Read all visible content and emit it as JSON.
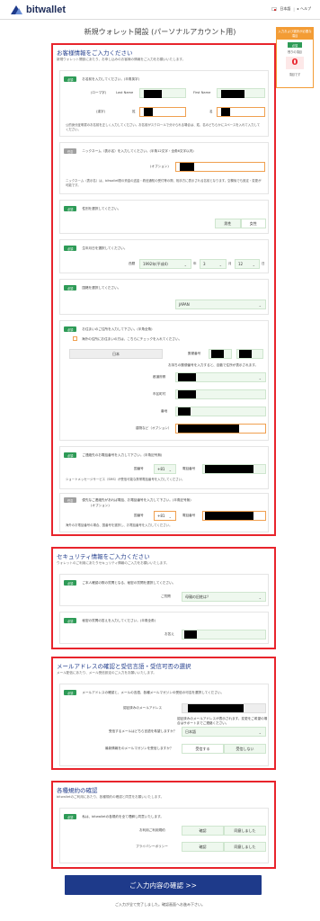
{
  "header": {
    "logo_text": "bitwallet",
    "language": "日本語",
    "separator": "|",
    "help": "▸ ヘルプ"
  },
  "page_title": "新規ウォレット開設 (パーソナルアカウント用)",
  "side": {
    "head": "入力および選択が必要な項目",
    "badge": "必須",
    "remaining_label": "残りの項目",
    "remaining_count": "0",
    "footer": "項目です"
  },
  "sec1": {
    "title": "お客様情報をご入力ください",
    "subtitle": "新規ウォレット開設にあたり、お申し込みのお客様の情報をご入力をお願いいたします。",
    "badge_required": "必須",
    "badge_optional": "任意",
    "name_prompt": "お名前を入力してください。(半角英字)",
    "roman_label": "(ローマ字)",
    "last_name_label": "Last Name",
    "first_name_label": "First Name",
    "kanji_label": "(漢字)",
    "sei_label": "姓",
    "mei_label": "名",
    "name_note": "公的身分証明書のお名前を正しく入力してください。お名前がスクロールで分けられる場合は、姓、名のどちらかにスペースを入れて入力してください。",
    "nickname_prompt": "ニックネーム（表示名）を入力してください。(半角12文字・全角6文字以内)",
    "nickname_optional": "(オプション)",
    "nickname_note": "ニックネーム（表示名）は、bitwallet間の資金の送金・着信通知の受付等の際、相手方に表示される名前となります。空欄後でも設定・変更が可能です。",
    "gender_prompt": "性別を選択してください。",
    "gender_male": "男性",
    "gender_female": "女性",
    "dob_prompt": "生年月日を選択してください。",
    "dob_label": "西暦",
    "dob_year": "1992年(平成4)",
    "dob_year_unit": "年",
    "dob_month": "3",
    "dob_month_unit": "月",
    "dob_day": "12",
    "dob_day_unit": "日",
    "country_prompt": "国籍を選択してください。",
    "country_value": "JAPAN",
    "address_prompt": "お住まいのご住所を入力して下さい。(半角全角)",
    "address_overseas": "海外の住所にお住まいの方は、こちらにチェックを入れてください。",
    "address_country": "日本",
    "postal_label": "郵便番号",
    "postal_note": "お持ちの郵便番号を入力すると、自動で住所が表示されます。",
    "pref_label": "都道府県",
    "city_label": "市区町村",
    "street_label": "番地",
    "building_label": "建物など（オプション）",
    "phone_prompt": "ご連絡先のお電話番号を入力して下さい。(半角記号無)",
    "country_code_label": "国番号",
    "country_code": "+81",
    "phone_label": "電話番号",
    "phone_note": "ショートメッセージサービス（SMS）が受信可能な携帯電話番号を入力してください。",
    "phone2_prompt": "優先なご連絡先があれば電話、お電話番号を入力して下さい。(半角記号無)",
    "phone2_optional": "(オプション)",
    "country_code2": "+81",
    "phone2_note": "海外のお電話番号の場合、国番号を選択し、お電話番号を入力してください。"
  },
  "sec2": {
    "title": "セキュリティ情報をご入力ください",
    "subtitle": "ウォレットのご利用にあたりセキュリティ情報のご入力をお願いいたします。",
    "badge_required": "必須",
    "question_prompt": "ご本人確認の際の質問となる、秘密の質問を選択してください。",
    "question_label": "ご質問",
    "question_value": "母親の旧姓は？",
    "answer_prompt": "秘密の質問の答えを入力してください。(半角全角)",
    "answer_label": "お答え"
  },
  "sec3": {
    "title": "メールアドレスの確認と受信言語・受信可否の選択",
    "subtitle": "メール配信にあたり、メール受信設定のご入力をお願いいたします。",
    "badge_required": "必須",
    "prompt": "メールアドレスの確認と、メールの言語、各種メールマガジンの受信の可否を選択してください。",
    "email_label": "認証済みのメールアドレス",
    "email_note": "認証済みのメールアドレスが表示されます。変更をご希望の場合はサポートまでご連絡ください。",
    "lang_label": "受信するメールはどちら言語を希望しますか？",
    "lang_value": "日本語",
    "magazine_label": "最新情報をのメールマガジンを受信しますか？",
    "receive": "受信する",
    "not_receive": "受信しない"
  },
  "sec4": {
    "title": "各種規約の確認",
    "subtitle": "bitwalletのご利用にあたり、各種規約の確認と同意をお願いいたします。",
    "badge_required": "必須",
    "prompt": "私は、bitwalletの各規約を全て理解し同意いたします。",
    "terms_label": "お利用ご利用規約",
    "privacy_label": "プライバシーポリシー",
    "confirm": "確認",
    "agreed": "同意しました"
  },
  "confirm_button": "ご入力内容の確認 >>",
  "confirm_note": "ご入力が全て完了しました。確認画面へお進み下さい。"
}
